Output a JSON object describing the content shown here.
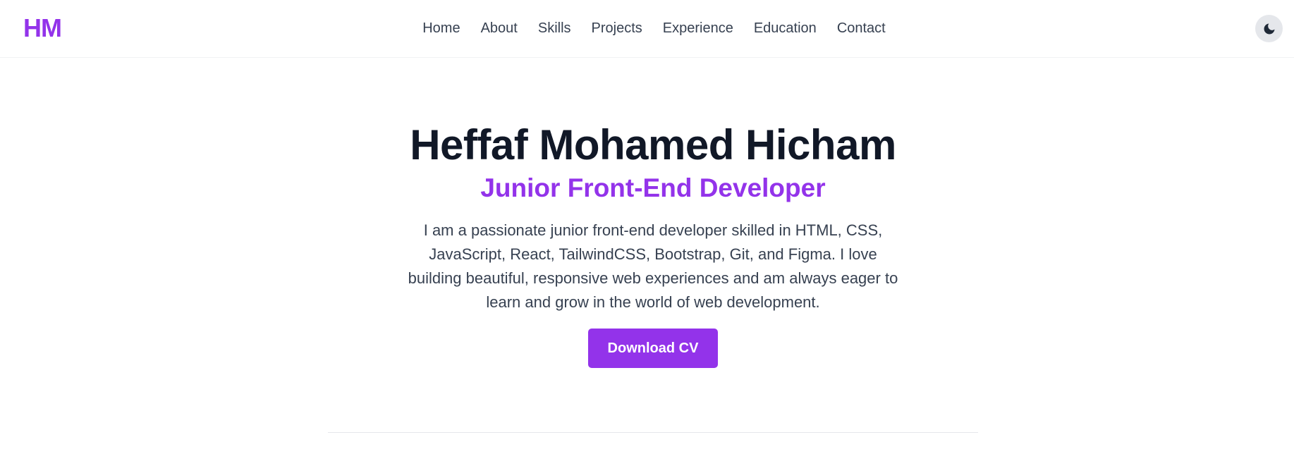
{
  "brand": {
    "logo_text": "HM",
    "accent_color": "#9333ea"
  },
  "nav": {
    "items": [
      {
        "label": "Home"
      },
      {
        "label": "About"
      },
      {
        "label": "Skills"
      },
      {
        "label": "Projects"
      },
      {
        "label": "Experience"
      },
      {
        "label": "Education"
      },
      {
        "label": "Contact"
      }
    ],
    "theme_toggle_icon": "moon-icon"
  },
  "hero": {
    "name": "Heffaf Mohamed Hicham",
    "role": "Junior Front-End Developer",
    "bio": "I am a passionate junior front-end developer skilled in HTML, CSS, JavaScript, React, TailwindCSS, Bootstrap, Git, and Figma. I love building beautiful, responsive web experiences and am always eager to learn and grow in the world of web development.",
    "cta_label": "Download CV"
  }
}
